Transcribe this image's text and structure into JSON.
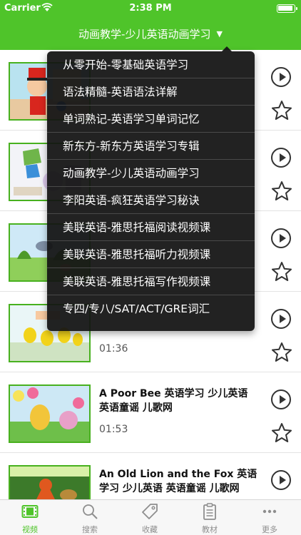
{
  "status_bar": {
    "carrier": "Carrier",
    "time": "2:38 PM"
  },
  "nav": {
    "title": "动画教学-少儿英语动画学习"
  },
  "dropdown": {
    "items": [
      "从零开始-零基础英语学习",
      "语法精髓-英语语法详解",
      "单词熟记-英语学习单词记忆",
      "新东方-新东方英语学习专辑",
      "动画教学-少儿英语动画学习",
      "李阳英语-疯狂英语学习秘诀",
      "美联英语-雅思托福阅读视频课",
      "美联英语-雅思托福听力视频课",
      "美联英语-雅思托福写作视频课",
      "专四/专八/SAT/ACT/GRE词汇"
    ]
  },
  "list": {
    "rows": [
      {
        "title": "",
        "duration": ""
      },
      {
        "title": "",
        "duration": ""
      },
      {
        "title": "",
        "duration": ""
      },
      {
        "title": "",
        "duration": "01:36"
      },
      {
        "title": "A Poor Bee 英语学习 少儿英语 英语童谣 儿歌网",
        "duration": "01:53"
      },
      {
        "title": "An Old Lion and the Fox 英语学习 少儿英语 英语童谣 儿歌网",
        "duration": ""
      }
    ]
  },
  "tabs": [
    {
      "label": "视频",
      "icon": "film-icon"
    },
    {
      "label": "搜索",
      "icon": "search-icon"
    },
    {
      "label": "收藏",
      "icon": "tag-icon"
    },
    {
      "label": "教材",
      "icon": "clipboard-icon"
    },
    {
      "label": "更多",
      "icon": "more-icon"
    }
  ],
  "colors": {
    "accent": "#4fc42a",
    "thumb_border": "#48b11f",
    "menu_bg": "#141414"
  }
}
